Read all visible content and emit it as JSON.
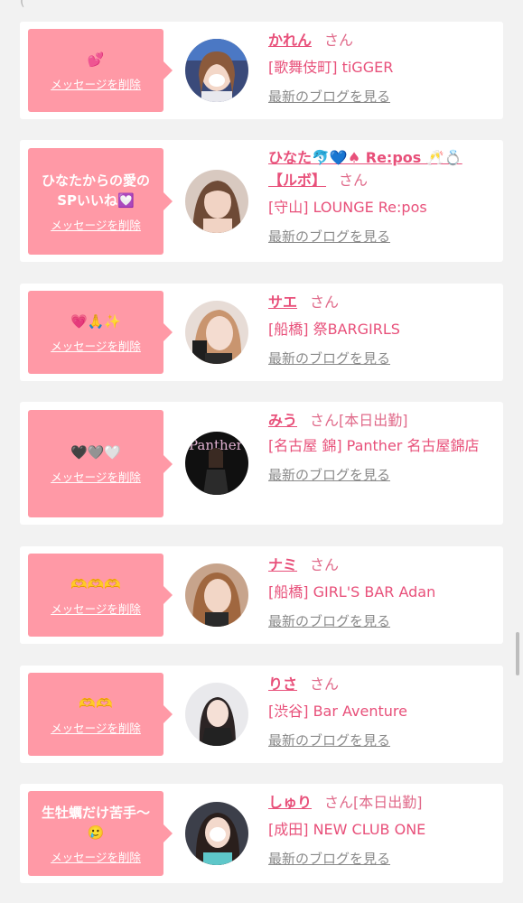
{
  "top_fragment": "(",
  "delete_label": "メッセージを削除",
  "san_label": "さん",
  "blog_label": "最新のブログを見る",
  "colors": {
    "bubble": "#ff99a6",
    "accent": "#e8507a",
    "card": "#ffffff",
    "page": "#f2f2f2"
  },
  "items": [
    {
      "message": "💕",
      "name": "かれん",
      "status": "",
      "shop": "[歌舞伎町] tiGGER",
      "avatar_icon": "woman-portrait-icon"
    },
    {
      "message": "ひなたからの愛のSPいいね💟",
      "name": "ひなた🐬💙♠ Re:pos 🥂💍【ルボ】",
      "status": "",
      "shop": "[守山] LOUNGE Re:pos",
      "avatar_icon": "woman-portrait-icon"
    },
    {
      "message": "💗🙏✨",
      "name": "サエ",
      "status": "",
      "shop": "[船橋] 祭BARGIRLS",
      "avatar_icon": "woman-portrait-icon"
    },
    {
      "message": "🖤🩶🤍",
      "name": "みう",
      "status": "[本日出勤]",
      "shop": "[名古屋 錦] Panther 名古屋錦店",
      "avatar_icon": "woman-portrait-icon"
    },
    {
      "message": "🫶🫶🫶",
      "name": "ナミ",
      "status": "",
      "shop": "[船橋] GIRL'S BAR Adan",
      "avatar_icon": "woman-portrait-icon"
    },
    {
      "message": "🫶🫶",
      "name": "りさ",
      "status": "",
      "shop": "[渋谷] Bar Aventure",
      "avatar_icon": "woman-portrait-icon"
    },
    {
      "message": "生牡蠣だけ苦手〜🥲",
      "name": "しゅり",
      "status": "[本日出勤]",
      "shop": "[成田] NEW CLUB ONE",
      "avatar_icon": "woman-portrait-icon"
    }
  ]
}
